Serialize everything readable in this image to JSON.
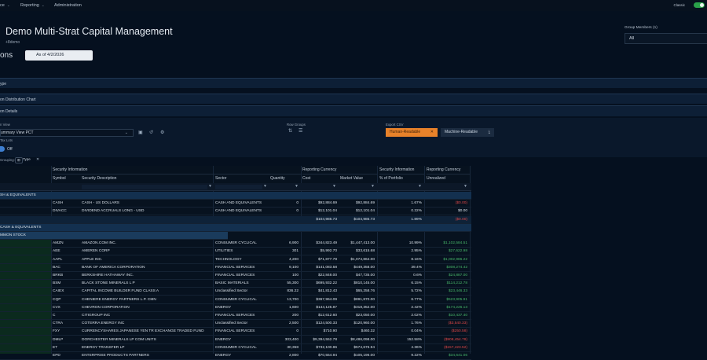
{
  "nav": {
    "items": [
      {
        "label": "ce",
        "has_chevron": true
      },
      {
        "label": "Reporting",
        "has_chevron": true
      },
      {
        "label": "Administration",
        "has_chevron": false
      }
    ],
    "classic_label": "Classic",
    "classic_on": true
  },
  "header": {
    "title": "Demo Multi-Strat Capital Management",
    "subtitle": "+8domo",
    "page_heading": "ons",
    "as_of": "As of 4/2/2026",
    "group_members_label": "Group Members (1)",
    "group_members_value": "All"
  },
  "bands": {
    "type": "ype",
    "distribution_chart": "on Distribution Chart",
    "details": "on Details"
  },
  "controls": {
    "view_label": "n View",
    "view_value": "ummary View PCT",
    "row_groups_label": "Row Groups",
    "export_label": "Export CSV",
    "human_readable": "Human-Readable",
    "machine_readable": "Machine-Readable",
    "tax_lots_label": "Tax Lots",
    "tax_lots_value": "Off",
    "grouping_label": "Grouping:",
    "grouping_chip": "Type",
    "human_color": "#e8822a"
  },
  "grid": {
    "group_headers": [
      "Security Information",
      "Reporting Currency",
      "Security Information",
      "Reporting Currency"
    ],
    "columns": [
      "Symbol",
      "Security Description",
      "Sector",
      "Quantity",
      "Cost",
      "Market Value",
      "% of Portfolio",
      "Unrealized"
    ],
    "rows": [
      {
        "kind": "group",
        "label": "SH & EQUIVALENTS"
      },
      {
        "kind": "data",
        "cells": [
          "CASH",
          "CASH - US DOLLARS",
          "CASH AND EQUIVALENTS",
          "0",
          "$92,884.69",
          "$92,884.69",
          "1.67%",
          "($0.00)"
        ],
        "sign": "neg"
      },
      {
        "kind": "data",
        "cells": [
          "DIVACC",
          "DIVIDEND ACCRUALS LONG - USD",
          "CASH AND EQUIVALENTS",
          "0",
          "$12,101.04",
          "$12,101.04",
          "0.22%",
          "$0.00"
        ],
        "sign": "zero"
      },
      {
        "kind": "subtotal",
        "cells": [
          "",
          "",
          "",
          "",
          "$104,985.73",
          "$104,985.73",
          "1.89%",
          "($0.00)"
        ],
        "sign": "neg"
      },
      {
        "kind": "group",
        "label": "CASH & EQUIVALENTS"
      },
      {
        "kind": "group2",
        "label": "MMON STOCK"
      },
      {
        "kind": "data",
        "cells": [
          "AMZN",
          "AMAZON.COM INC.",
          "CONSUMER CYCLICAL",
          "6,900",
          "$344,823.49",
          "$1,447,413.00",
          "10.99%",
          "$1,102,584.51"
        ],
        "sign": "pos"
      },
      {
        "kind": "data",
        "cells": [
          "AEE",
          "AMEREN CORP",
          "UTILITIES",
          "301",
          "$5,992.70",
          "$33,615.68",
          "2.95%",
          "$27,622.98"
        ],
        "sign": "pos"
      },
      {
        "kind": "data",
        "cells": [
          "AAPL",
          "APPLE INC.",
          "TECHNOLOGY",
          "4,200",
          "$71,877.78",
          "$1,074,864.00",
          "8.16%",
          "$1,002,986.22"
        ],
        "sign": "pos"
      },
      {
        "kind": "data",
        "cells": [
          "BAC",
          "BANK OF AMERICA CORPORATION",
          "FINANCIAL SERVICES",
          "9,100",
          "$141,083.58",
          "$449,358.00",
          "39.4%",
          "$308,274.42"
        ],
        "sign": "pos"
      },
      {
        "kind": "data",
        "cells": [
          "BRKB",
          "BERKSHIRE HATHAWAY INC.",
          "FINANCIAL SERVICES",
          "100",
          "$22,848.00",
          "$47,735.00",
          "0.6%",
          "$24,887.00"
        ],
        "sign": "pos"
      },
      {
        "kind": "data",
        "cells": [
          "BSM",
          "BLACK STONE MINERALS L P",
          "BASIC MATERIALS",
          "55,300",
          "$695,932.22",
          "$810,145.00",
          "6.15%",
          "$114,212.78"
        ],
        "sign": "pos"
      },
      {
        "kind": "data",
        "cells": [
          "CAIEX",
          "CAPITAL INCOME BUILDER FUND CLASS A",
          "Unclassified Sector",
          "836.22",
          "$41,812.43",
          "$65,258.76",
          "5.72%",
          "$23,446.33"
        ],
        "sign": "pos"
      },
      {
        "kind": "data",
        "cells": [
          "CQP",
          "CHENIERE ENERGY PARTNERS L.P. CMN",
          "CONSUMER CYCLICAL",
          "13,700",
          "$367,964.09",
          "$891,870.00",
          "6.77%",
          "$523,905.91"
        ],
        "sign": "pos"
      },
      {
        "kind": "data",
        "cells": [
          "CVX",
          "CHEVRON CORPORATION",
          "ENERGY",
          "1,600",
          "$144,125.87",
          "$318,352.00",
          "2.42%",
          "$174,226.13"
        ],
        "sign": "pos"
      },
      {
        "kind": "data",
        "cells": [
          "C",
          "CITIGROUP INC",
          "FINANCIAL SERVICES",
          "200",
          "$12,612.60",
          "$23,050.00",
          "2.02%",
          "$10,437.40"
        ],
        "sign": "pos"
      },
      {
        "kind": "data",
        "cells": [
          "CTRA",
          "COTERRA ENERGY INC",
          "Unclassified Sector",
          "2,500",
          "$124,500.33",
          "$120,960.00",
          "1.76%",
          "($3,540.33)"
        ],
        "sign": "neg"
      },
      {
        "kind": "data",
        "cells": [
          "FXY",
          "CURRENCYSHARES JAPANESE YEN TR EXCHANGE TRADED FUND",
          "FINANCIAL SERVICES",
          "0",
          "$710.90",
          "$460.32",
          "0.04%",
          "($250.58)"
        ],
        "sign": "neg"
      },
      {
        "kind": "data",
        "cells": [
          "DMLP",
          "DORCHESTER MINERALS LP COM UNITS",
          "ENERGY",
          "303,400",
          "$9,394,552.78",
          "$8,486,098.00",
          "152.58%",
          "($908,454.78)"
        ],
        "sign": "neg"
      },
      {
        "kind": "data",
        "cells": [
          "ET",
          "ENERGY TRANSFER LP",
          "CONSUMER CYCLICAL",
          "30,358",
          "$732,100.86",
          "$574,676.94",
          "4.36%",
          "($157,423.52)"
        ],
        "sign": "neg"
      },
      {
        "kind": "data",
        "cells": [
          "EPD",
          "ENTERPRISE PRODUCTS PARTNERS",
          "ENERGY",
          "2,800",
          "$70,554.94",
          "$105,196.00",
          "9.22%",
          "$34,641.06"
        ],
        "sign": "pos"
      }
    ]
  },
  "colors": {
    "accent": "#3e7fd1",
    "positive": "#48b86a",
    "negative": "#e04848",
    "toggle_on": "#2aa14a"
  }
}
